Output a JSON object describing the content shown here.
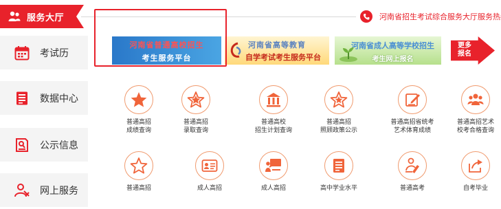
{
  "header": {
    "hall_title": "服务大厅",
    "hotline": "河南省招生考试综合服务大厅服务热线"
  },
  "sidebar": {
    "items": [
      {
        "label": "考试历",
        "icon": "calendar-icon"
      },
      {
        "label": "数据中心",
        "icon": "document-icon"
      },
      {
        "label": "公示信息",
        "icon": "announcement-icon"
      },
      {
        "label": "网上服务",
        "icon": "user-service-icon"
      }
    ]
  },
  "banners": [
    {
      "line1": "河南省普通高校招生",
      "line2": "考生服务平台"
    },
    {
      "line1": "河南省高等教育",
      "line2": "自学考试考生服务平台"
    },
    {
      "line1": "河南省成人高等学校招生",
      "line2": "考生网上报名"
    },
    {
      "line1": "更多",
      "line2": "报名"
    }
  ],
  "services": [
    {
      "line1": "普通高招",
      "line2": "成绩查询",
      "icon": "star-filled-icon"
    },
    {
      "line1": "普通高招",
      "line2": "录取查询",
      "icon": "star-outline-icon"
    },
    {
      "line1": "普通高校",
      "line2": "招生计划查询",
      "icon": "building-icon"
    },
    {
      "line1": "普通高招",
      "line2": "照顾政策公示",
      "icon": "star-badge-icon"
    },
    {
      "line1": "普通高招省统考",
      "line2": "艺术体育成绩",
      "icon": "edit-icon"
    },
    {
      "line1": "普通高招艺术",
      "line2": "校考合格查询",
      "icon": "group-icon"
    },
    {
      "line1": "普通高招",
      "line2": "",
      "icon": "star-outline-icon"
    },
    {
      "line1": "成人高招",
      "line2": "",
      "icon": "id-card-icon"
    },
    {
      "line1": "成人高招",
      "line2": "",
      "icon": "presentation-icon"
    },
    {
      "line1": "高中学业水平",
      "line2": "",
      "icon": "document-list-icon"
    },
    {
      "line1": "普通高考",
      "line2": "",
      "icon": "person-study-icon"
    },
    {
      "line1": "自考毕业",
      "line2": "",
      "icon": "share-icon"
    }
  ],
  "colors": {
    "accent": "#e8222b",
    "icon_orange": "#f0643a",
    "circle_border": "#f09a6e",
    "nav_bg": "#f4f4f4"
  }
}
